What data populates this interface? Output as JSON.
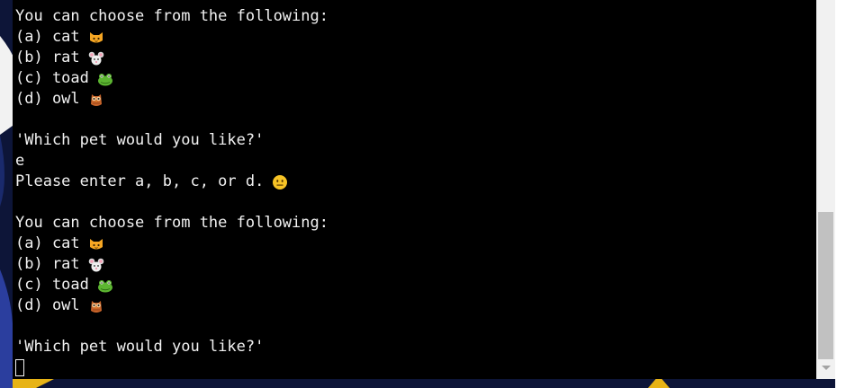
{
  "terminal": {
    "lines": [
      {
        "text": "You can choose from the following:",
        "emoji": ""
      },
      {
        "text": "(a) cat",
        "emoji": "cat-face-icon"
      },
      {
        "text": "(b) rat",
        "emoji": "mouse-face-icon"
      },
      {
        "text": "(c) toad",
        "emoji": "frog-face-icon"
      },
      {
        "text": "(d) owl",
        "emoji": "owl-icon"
      },
      {
        "text": "",
        "emoji": ""
      },
      {
        "text": "'Which pet would you like?'",
        "emoji": ""
      },
      {
        "text": "e",
        "emoji": ""
      },
      {
        "text": "Please enter a, b, c, or d.",
        "emoji": "neutral-face-icon"
      },
      {
        "text": "",
        "emoji": ""
      },
      {
        "text": "You can choose from the following:",
        "emoji": ""
      },
      {
        "text": "(a) cat",
        "emoji": "cat-face-icon"
      },
      {
        "text": "(b) rat",
        "emoji": "mouse-face-icon"
      },
      {
        "text": "(c) toad",
        "emoji": "frog-face-icon"
      },
      {
        "text": "(d) owl",
        "emoji": "owl-icon"
      },
      {
        "text": "",
        "emoji": ""
      },
      {
        "text": "'Which pet would you like?'",
        "emoji": ""
      }
    ],
    "input_value": ""
  },
  "colors": {
    "terminal_bg": "#000000",
    "terminal_fg": "#f2f2f2",
    "page_bg": "#0d1538",
    "scrollbar_track": "#f1f1f1",
    "scrollbar_thumb": "#c1c1c1"
  }
}
